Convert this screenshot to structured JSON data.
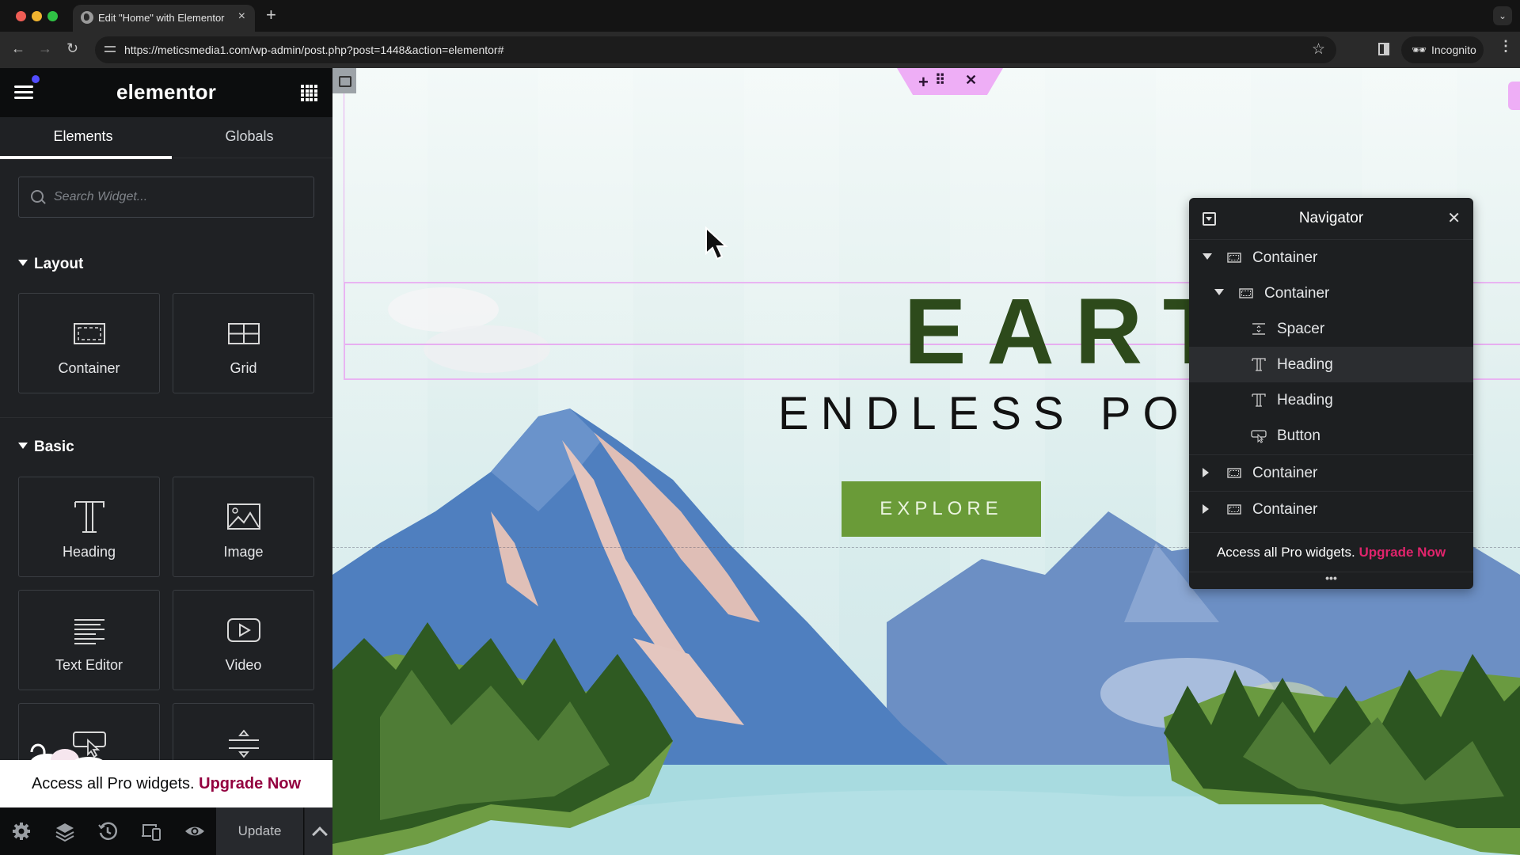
{
  "browser": {
    "tab_title": "Edit \"Home\" with Elementor",
    "tab_close": "×",
    "new_tab": "+",
    "tabs_dropdown": "⌄",
    "url": "https://meticsmedia1.com/wp-admin/post.php?post=1448&action=elementor#",
    "incognito_label": "Incognito",
    "nav": {
      "back": "←",
      "forward": "→",
      "reload": "↻",
      "star": "☆",
      "menu": "⋮"
    }
  },
  "sidebar": {
    "logo": "elementor",
    "tabs": [
      {
        "label": "Elements",
        "active": true
      },
      {
        "label": "Globals",
        "active": false
      }
    ],
    "search": {
      "placeholder": "Search Widget...",
      "value": ""
    },
    "sections": [
      {
        "title": "Layout",
        "widgets": [
          {
            "label": "Container",
            "icon": "container-icon"
          },
          {
            "label": "Grid",
            "icon": "grid-icon"
          }
        ]
      },
      {
        "title": "Basic",
        "widgets": [
          {
            "label": "Heading",
            "icon": "heading-icon"
          },
          {
            "label": "Image",
            "icon": "image-icon"
          },
          {
            "label": "Text Editor",
            "icon": "text-editor-icon"
          },
          {
            "label": "Video",
            "icon": "video-icon"
          },
          {
            "label": "Button",
            "icon": "button-icon"
          },
          {
            "label": "Divider",
            "icon": "divider-icon"
          }
        ]
      }
    ],
    "pro_banner": {
      "text": "Access all Pro widgets.",
      "link": "Upgrade Now"
    },
    "footer": {
      "icons": [
        "settings-icon",
        "navigator-layers-icon",
        "history-icon",
        "responsive-mode-icon",
        "preview-eye-icon"
      ],
      "update_label": "Update"
    },
    "collapse_handle": "‹"
  },
  "canvas": {
    "toolbar": {
      "add": "+",
      "move": "⠿",
      "close": "✕"
    },
    "heading_main": "EARTH",
    "heading_sub": "ENDLESS POTENTIAL",
    "button_label": "EXPLORE",
    "colors": {
      "heading": "#2d4a1b",
      "button": "#6a9b38",
      "outline": "#e7aef0"
    }
  },
  "navigator": {
    "title": "Navigator",
    "close": "✕",
    "items": [
      {
        "label": "Container",
        "type": "container",
        "depth": 0,
        "expander": "down",
        "selected": false
      },
      {
        "label": "Container",
        "type": "container",
        "depth": 1,
        "expander": "down",
        "selected": false
      },
      {
        "label": "Spacer",
        "type": "spacer",
        "depth": 2,
        "expander": "none",
        "selected": false
      },
      {
        "label": "Heading",
        "type": "heading",
        "depth": 2,
        "expander": "none",
        "selected": true
      },
      {
        "label": "Heading",
        "type": "heading",
        "depth": 2,
        "expander": "none",
        "selected": false
      },
      {
        "label": "Button",
        "type": "button",
        "depth": 2,
        "expander": "none",
        "selected": false
      },
      {
        "label": "Container",
        "type": "container",
        "depth": 0,
        "expander": "right",
        "selected": false
      },
      {
        "label": "Container",
        "type": "container",
        "depth": 0,
        "expander": "right",
        "selected": false
      }
    ],
    "promo": {
      "text": "Access all Pro widgets.",
      "link": "Upgrade Now"
    },
    "more": "•••"
  }
}
